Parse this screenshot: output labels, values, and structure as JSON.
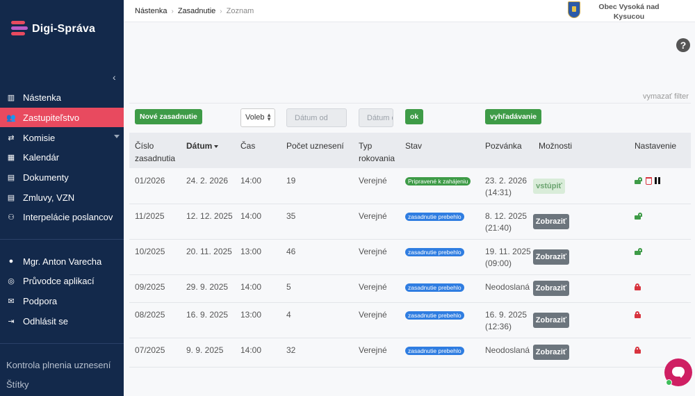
{
  "app": {
    "name": "Digi-Správa"
  },
  "colors": {
    "sidebar_bg": "#13294b",
    "active": "#e84a5f",
    "green": "#3e9b47",
    "blue_badge": "#2f7de1",
    "gray_button": "#6c757d",
    "lock_open": "#3e9b47",
    "lock_closed": "#d8343f",
    "chat": "#cf1f63"
  },
  "sidebar": {
    "collapse_icon": "chevron-left-icon",
    "items": [
      {
        "label": "Nástenka",
        "icon": "columns-icon",
        "glyph": "▥"
      },
      {
        "label": "Zastupiteľstvo",
        "icon": "users-icon",
        "glyph": "👥",
        "active": true
      },
      {
        "label": "Komisie",
        "icon": "handshake-icon",
        "glyph": "⇄",
        "has_submenu": true
      },
      {
        "label": "Kalendár",
        "icon": "calendar-icon",
        "glyph": "▦"
      },
      {
        "label": "Dokumenty",
        "icon": "file-icon",
        "glyph": "▤"
      },
      {
        "label": "Zmluvy, VZN",
        "icon": "contract-icon",
        "glyph": "▤"
      },
      {
        "label": "Interpelácie poslancov",
        "icon": "people-arrows-icon",
        "glyph": "⚇"
      }
    ],
    "user_items": [
      {
        "label": "Mgr. Anton Varecha",
        "icon": "user-icon",
        "glyph": "●"
      },
      {
        "label": "Průvodce aplikací",
        "icon": "globe-icon",
        "glyph": "◎"
      },
      {
        "label": "Podpora",
        "icon": "comments-icon",
        "glyph": "✉"
      },
      {
        "label": "Odhlásit se",
        "icon": "sign-out-icon",
        "glyph": "⇥"
      }
    ],
    "bottom_items": [
      "Kontrola plnenia uznesení",
      "Štítky"
    ]
  },
  "breadcrumb": [
    "Nástenka",
    "Zasadnutie",
    "Zoznam"
  ],
  "organization": "Obec Vysoká nad Kysucou",
  "help_label": "?",
  "filters": {
    "clear_label": "vymazať filter",
    "new_meeting_label": "Nové zasadnutie",
    "select_value": "Voleb",
    "date_from_placeholder": "Dátum od",
    "date_to_placeholder": "Dátum do",
    "ok_label": "ok",
    "search_label": "vyhľadávanie"
  },
  "table": {
    "headers": {
      "number": "Číslo zasadnutia",
      "date": "Dátum",
      "time": "Čas",
      "resolutions": "Počet uznesení",
      "type": "Typ rokovania",
      "status": "Stav",
      "invitation": "Pozvánka",
      "options": "Možnosti",
      "settings": "Nastavenie"
    },
    "rows": [
      {
        "number": "01/2026",
        "date": "24. 2. 2026",
        "time": "14:00",
        "resolutions": "19",
        "type": "Verejné",
        "status": "Pripravené k zahájeniu",
        "status_color": "green",
        "invitation": "23. 2. 2026",
        "invitation_time": "(14:31)",
        "action": "vstúpiť",
        "lock": "open",
        "extra_icons": true
      },
      {
        "number": "11/2025",
        "date": "12. 12. 2025",
        "time": "14:00",
        "resolutions": "35",
        "type": "Verejné",
        "status": "zasadnutie prebehlo",
        "status_color": "blue",
        "invitation": "8. 12. 2025",
        "invitation_time": "(21:40)",
        "action": "Zobraziť",
        "lock": "open"
      },
      {
        "number": "10/2025",
        "date": "20. 11. 2025",
        "time": "13:00",
        "resolutions": "46",
        "type": "Verejné",
        "status": "zasadnutie prebehlo",
        "status_color": "blue",
        "invitation": "19. 11. 2025",
        "invitation_time": "(09:00)",
        "action": "Zobraziť",
        "lock": "open"
      },
      {
        "number": "09/2025",
        "date": "29. 9. 2025",
        "time": "14:00",
        "resolutions": "5",
        "type": "Verejné",
        "status": "zasadnutie prebehlo",
        "status_color": "blue",
        "invitation": "Neodoslaná",
        "invitation_time": "",
        "action": "Zobraziť",
        "lock": "closed"
      },
      {
        "number": "08/2025",
        "date": "16. 9. 2025",
        "time": "13:00",
        "resolutions": "4",
        "type": "Verejné",
        "status": "zasadnutie prebehlo",
        "status_color": "blue",
        "invitation": "16. 9. 2025",
        "invitation_time": "(12:36)",
        "action": "Zobraziť",
        "lock": "closed"
      },
      {
        "number": "07/2025",
        "date": "9. 9. 2025",
        "time": "14:00",
        "resolutions": "32",
        "type": "Verejné",
        "status": "zasadnutie prebehlo",
        "status_color": "blue",
        "invitation": "Neodoslaná",
        "invitation_time": "",
        "action": "Zobraziť",
        "lock": "closed"
      }
    ]
  },
  "chat_widget": {
    "icon": "chat-icon",
    "online": true
  }
}
